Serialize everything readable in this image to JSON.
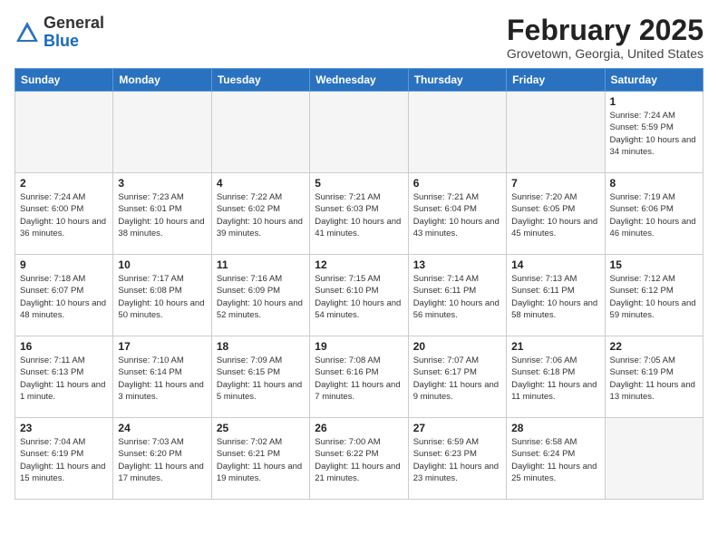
{
  "header": {
    "logo_general": "General",
    "logo_blue": "Blue",
    "month_title": "February 2025",
    "location": "Grovetown, Georgia, United States"
  },
  "weekdays": [
    "Sunday",
    "Monday",
    "Tuesday",
    "Wednesday",
    "Thursday",
    "Friday",
    "Saturday"
  ],
  "weeks": [
    [
      {
        "day": "",
        "info": "",
        "empty": true
      },
      {
        "day": "",
        "info": "",
        "empty": true
      },
      {
        "day": "",
        "info": "",
        "empty": true
      },
      {
        "day": "",
        "info": "",
        "empty": true
      },
      {
        "day": "",
        "info": "",
        "empty": true
      },
      {
        "day": "",
        "info": "",
        "empty": true
      },
      {
        "day": "1",
        "info": "Sunrise: 7:24 AM\nSunset: 5:59 PM\nDaylight: 10 hours\nand 34 minutes.",
        "empty": false
      }
    ],
    [
      {
        "day": "2",
        "info": "Sunrise: 7:24 AM\nSunset: 6:00 PM\nDaylight: 10 hours\nand 36 minutes.",
        "empty": false
      },
      {
        "day": "3",
        "info": "Sunrise: 7:23 AM\nSunset: 6:01 PM\nDaylight: 10 hours\nand 38 minutes.",
        "empty": false
      },
      {
        "day": "4",
        "info": "Sunrise: 7:22 AM\nSunset: 6:02 PM\nDaylight: 10 hours\nand 39 minutes.",
        "empty": false
      },
      {
        "day": "5",
        "info": "Sunrise: 7:21 AM\nSunset: 6:03 PM\nDaylight: 10 hours\nand 41 minutes.",
        "empty": false
      },
      {
        "day": "6",
        "info": "Sunrise: 7:21 AM\nSunset: 6:04 PM\nDaylight: 10 hours\nand 43 minutes.",
        "empty": false
      },
      {
        "day": "7",
        "info": "Sunrise: 7:20 AM\nSunset: 6:05 PM\nDaylight: 10 hours\nand 45 minutes.",
        "empty": false
      },
      {
        "day": "8",
        "info": "Sunrise: 7:19 AM\nSunset: 6:06 PM\nDaylight: 10 hours\nand 46 minutes.",
        "empty": false
      }
    ],
    [
      {
        "day": "9",
        "info": "Sunrise: 7:18 AM\nSunset: 6:07 PM\nDaylight: 10 hours\nand 48 minutes.",
        "empty": false
      },
      {
        "day": "10",
        "info": "Sunrise: 7:17 AM\nSunset: 6:08 PM\nDaylight: 10 hours\nand 50 minutes.",
        "empty": false
      },
      {
        "day": "11",
        "info": "Sunrise: 7:16 AM\nSunset: 6:09 PM\nDaylight: 10 hours\nand 52 minutes.",
        "empty": false
      },
      {
        "day": "12",
        "info": "Sunrise: 7:15 AM\nSunset: 6:10 PM\nDaylight: 10 hours\nand 54 minutes.",
        "empty": false
      },
      {
        "day": "13",
        "info": "Sunrise: 7:14 AM\nSunset: 6:11 PM\nDaylight: 10 hours\nand 56 minutes.",
        "empty": false
      },
      {
        "day": "14",
        "info": "Sunrise: 7:13 AM\nSunset: 6:11 PM\nDaylight: 10 hours\nand 58 minutes.",
        "empty": false
      },
      {
        "day": "15",
        "info": "Sunrise: 7:12 AM\nSunset: 6:12 PM\nDaylight: 10 hours\nand 59 minutes.",
        "empty": false
      }
    ],
    [
      {
        "day": "16",
        "info": "Sunrise: 7:11 AM\nSunset: 6:13 PM\nDaylight: 11 hours\nand 1 minute.",
        "empty": false
      },
      {
        "day": "17",
        "info": "Sunrise: 7:10 AM\nSunset: 6:14 PM\nDaylight: 11 hours\nand 3 minutes.",
        "empty": false
      },
      {
        "day": "18",
        "info": "Sunrise: 7:09 AM\nSunset: 6:15 PM\nDaylight: 11 hours\nand 5 minutes.",
        "empty": false
      },
      {
        "day": "19",
        "info": "Sunrise: 7:08 AM\nSunset: 6:16 PM\nDaylight: 11 hours\nand 7 minutes.",
        "empty": false
      },
      {
        "day": "20",
        "info": "Sunrise: 7:07 AM\nSunset: 6:17 PM\nDaylight: 11 hours\nand 9 minutes.",
        "empty": false
      },
      {
        "day": "21",
        "info": "Sunrise: 7:06 AM\nSunset: 6:18 PM\nDaylight: 11 hours\nand 11 minutes.",
        "empty": false
      },
      {
        "day": "22",
        "info": "Sunrise: 7:05 AM\nSunset: 6:19 PM\nDaylight: 11 hours\nand 13 minutes.",
        "empty": false
      }
    ],
    [
      {
        "day": "23",
        "info": "Sunrise: 7:04 AM\nSunset: 6:19 PM\nDaylight: 11 hours\nand 15 minutes.",
        "empty": false
      },
      {
        "day": "24",
        "info": "Sunrise: 7:03 AM\nSunset: 6:20 PM\nDaylight: 11 hours\nand 17 minutes.",
        "empty": false
      },
      {
        "day": "25",
        "info": "Sunrise: 7:02 AM\nSunset: 6:21 PM\nDaylight: 11 hours\nand 19 minutes.",
        "empty": false
      },
      {
        "day": "26",
        "info": "Sunrise: 7:00 AM\nSunset: 6:22 PM\nDaylight: 11 hours\nand 21 minutes.",
        "empty": false
      },
      {
        "day": "27",
        "info": "Sunrise: 6:59 AM\nSunset: 6:23 PM\nDaylight: 11 hours\nand 23 minutes.",
        "empty": false
      },
      {
        "day": "28",
        "info": "Sunrise: 6:58 AM\nSunset: 6:24 PM\nDaylight: 11 hours\nand 25 minutes.",
        "empty": false
      },
      {
        "day": "",
        "info": "",
        "empty": true
      }
    ]
  ]
}
